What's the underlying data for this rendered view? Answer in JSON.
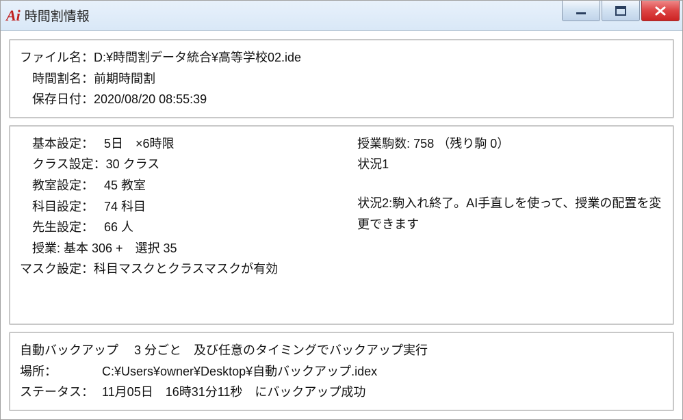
{
  "titlebar": {
    "icon_text": "Ai",
    "title": "時間割情報"
  },
  "file_info": {
    "file_label": "ファイル名：",
    "file_value": "D:¥時間割データ統合¥高等学校02.ide",
    "schedule_label": "時間割名：",
    "schedule_value": "前期時間割",
    "save_label": "保存日付：",
    "save_value": "2020/08/20  08:55:39"
  },
  "settings": {
    "basic_label": "基本設定：",
    "basic_value": "5日　×6時限",
    "class_label": "クラス設定：",
    "class_value": "30 クラス",
    "room_label": "教室設定：",
    "room_value": "45 教室",
    "subject_label": "科目設定：",
    "subject_value": "74 科目",
    "teacher_label": "先生設定：",
    "teacher_value": "66 人",
    "lesson_line": "授業: 基本 306 +　選択 35",
    "mask_label": "マスク設定：",
    "mask_value": "科目マスクとクラスマスクが有効"
  },
  "status": {
    "pieces": "授業駒数: 758 （残り駒 0）",
    "situation1": "状況1",
    "situation2": "状況2:駒入れ終了。AI手直しを使って、授業の配置を変更できます"
  },
  "backup": {
    "line1": "自動バックアップ　 3 分ごと　及び任意のタイミングでバックアップ実行",
    "location_label": "場所：",
    "location_value": "C:¥Users¥owner¥Desktop¥自動バックアップ.idex",
    "status_label": "ステータス：",
    "status_value": "11月05日　16時31分11秒　にバックアップ成功"
  }
}
